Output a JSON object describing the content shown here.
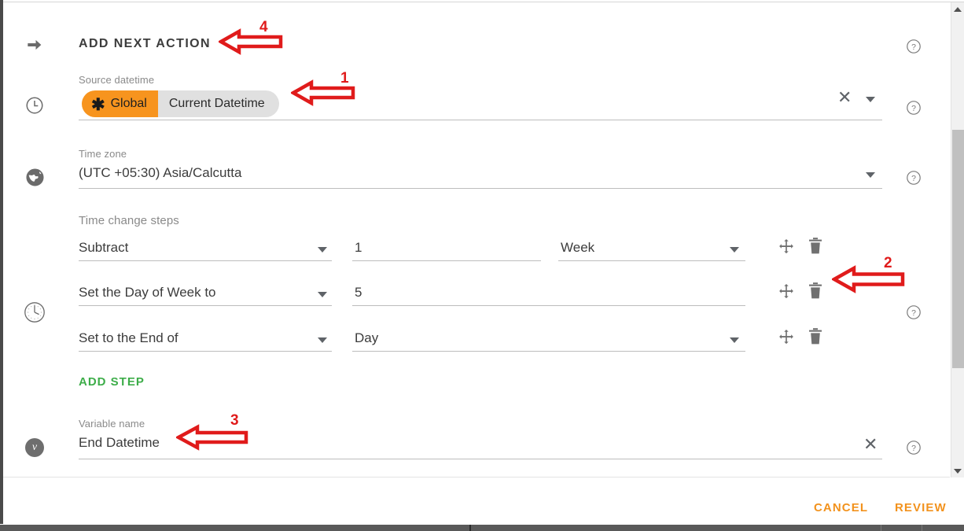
{
  "section": {
    "title": "ADD NEXT ACTION"
  },
  "source_datetime": {
    "label": "Source datetime",
    "chip_scope": "Global",
    "chip_value": "Current Datetime",
    "star_glyph": "✱",
    "clear_glyph": "✕"
  },
  "time_zone": {
    "label": "Time zone",
    "value": "(UTC +05:30) Asia/Calcutta"
  },
  "time_change_steps": {
    "label": "Time change steps",
    "rows": [
      {
        "operation": "Subtract",
        "value": "1",
        "unit": "Week",
        "unit_has_dropdown": true,
        "value_has_dropdown": false
      },
      {
        "operation": "Set the Day of Week to",
        "value": "5",
        "unit": "",
        "unit_has_dropdown": false,
        "value_has_dropdown": false
      },
      {
        "operation": "Set to the End of",
        "value": "Day",
        "unit": "",
        "unit_has_dropdown": false,
        "value_has_dropdown": true
      }
    ],
    "add_step_label": "ADD STEP"
  },
  "variable": {
    "label": "Variable name",
    "value": "End Datetime",
    "badge_glyph": "v",
    "clear_glyph": "✕"
  },
  "footer": {
    "cancel_label": "CANCEL",
    "review_label": "REVIEW"
  },
  "gutter_icons": [
    {
      "name": "arrow-right-icon"
    },
    {
      "name": "clock-simple-icon"
    },
    {
      "name": "globe-icon"
    },
    {
      "name": "clock-detailed-icon"
    },
    {
      "name": "variable-badge-icon"
    }
  ],
  "annotations": [
    {
      "number": "1",
      "target": "source-datetime-chip"
    },
    {
      "number": "2",
      "target": "step-row-delete-icon"
    },
    {
      "number": "3",
      "target": "variable-name-field"
    },
    {
      "number": "4",
      "target": "add-next-action-title"
    }
  ],
  "colors": {
    "accent_orange": "#f7941e",
    "footer_orange": "#f2921d",
    "add_step_green": "#3dad49",
    "annotation_red": "#e01b1b",
    "text_primary": "#3c3c3c",
    "text_muted": "#8a8a8a"
  },
  "scrollbar": {
    "up_arrow": "scrollbar-up-arrow",
    "down_arrow": "scrollbar-down-arrow"
  }
}
